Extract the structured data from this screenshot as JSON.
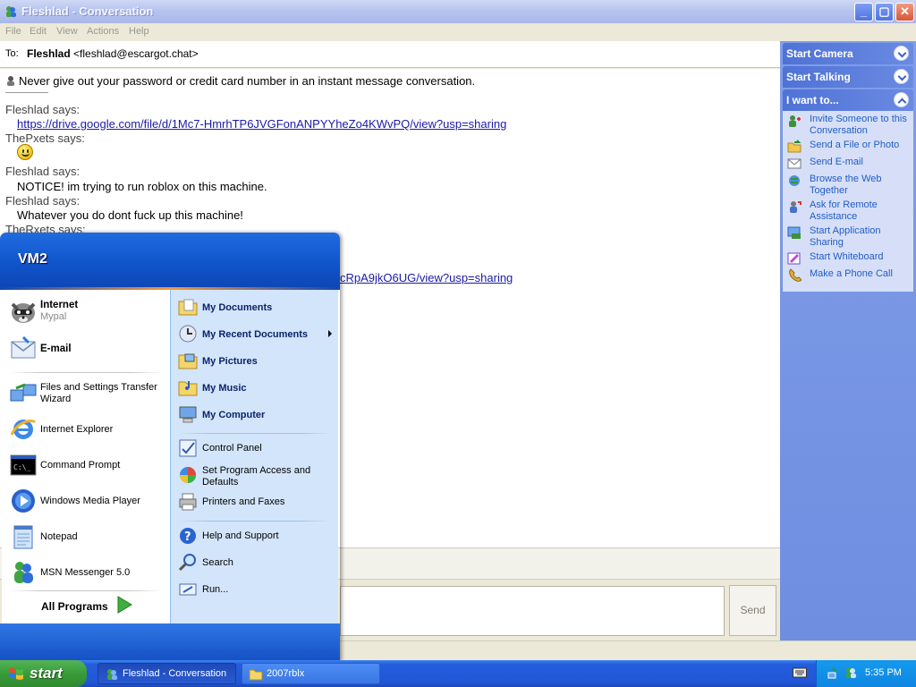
{
  "window": {
    "title": "Fleshlad - Conversation",
    "menu": [
      "File",
      "Edit",
      "View",
      "Actions",
      "Help"
    ]
  },
  "to_bar": {
    "label": "To:",
    "name": "Fleshlad",
    "email": "<fleshlad@escargot.chat>"
  },
  "conversation": {
    "warning": "Never give out your password or credit card number in an instant message conversation.",
    "lines": [
      {
        "kind": "says",
        "text": "Fleshlad says:"
      },
      {
        "kind": "link",
        "text": "https://drive.google.com/file/d/1Mc7-HmrhTP6JVGFonANPYYheZo4KWvPQ/view?usp=sharing"
      },
      {
        "kind": "says",
        "text": "ThePxets says:"
      },
      {
        "kind": "says",
        "text": "Fleshlad says:"
      },
      {
        "kind": "msg",
        "text": "NOTICE! im trying to run roblox on this machine."
      },
      {
        "kind": "says",
        "text": "Fleshlad says:"
      },
      {
        "kind": "msg",
        "text": "Whatever you do dont fuck up this machine!"
      },
      {
        "kind": "says",
        "text": "TheRxets says:"
      },
      {
        "kind": "link",
        "text": "cRpA9jkO6UG/view?usp=sharing"
      }
    ]
  },
  "compose": {
    "send_label": "Send"
  },
  "task_pane": {
    "start_camera": "Start Camera",
    "start_talking": "Start Talking",
    "i_want_to": "I want to...",
    "items": [
      {
        "label": "Invite Someone to this Conversation",
        "icon": "invite-icon"
      },
      {
        "label": "Send a File or Photo",
        "icon": "send-file-icon"
      },
      {
        "label": "Send E-mail",
        "icon": "email-icon"
      },
      {
        "label": "Browse the Web Together",
        "icon": "browse-icon"
      },
      {
        "label": "Ask for Remote Assistance",
        "icon": "remote-assistance-icon"
      },
      {
        "label": "Start Application Sharing",
        "icon": "app-sharing-icon"
      },
      {
        "label": "Start Whiteboard",
        "icon": "whiteboard-icon"
      },
      {
        "label": "Make a Phone Call",
        "icon": "phone-icon"
      }
    ]
  },
  "start_menu": {
    "user": "VM2",
    "pinned": [
      {
        "title": "Internet",
        "sub": "Mypal"
      },
      {
        "title": "E-mail",
        "sub": ""
      }
    ],
    "recent": [
      "Files and Settings Transfer Wizard",
      "Internet Explorer",
      "Command Prompt",
      "Windows Media Player",
      "Notepad",
      "MSN Messenger 5.0"
    ],
    "all_programs": "All Programs",
    "places": [
      "My Documents",
      "My Recent Documents",
      "My Pictures",
      "My Music",
      "My Computer"
    ],
    "system": [
      "Control Panel",
      "Set Program Access and Defaults",
      "Printers and Faxes"
    ],
    "support": [
      "Help and Support",
      "Search",
      "Run..."
    ]
  },
  "taskbar": {
    "start_label": "start",
    "tasks": [
      "Fleshlad - Conversation",
      "2007rblx"
    ],
    "clock": "5:35 PM"
  }
}
